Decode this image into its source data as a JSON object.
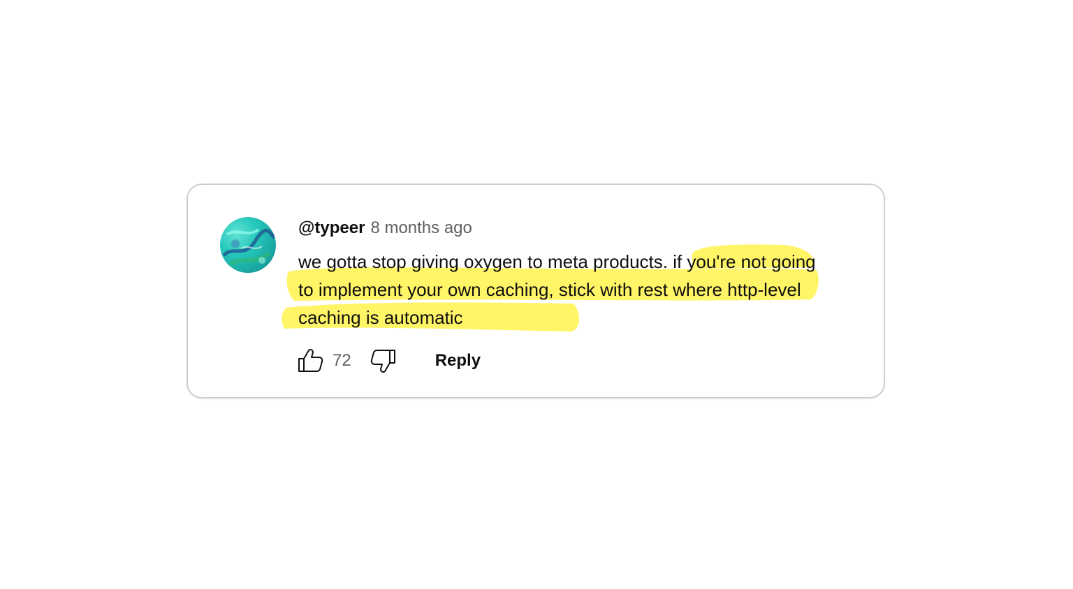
{
  "comment": {
    "author": "@typeer",
    "timestamp": "8 months ago",
    "text_plain": "we gotta stop giving oxygen to meta products",
    "text_highlighted": ". if you're not going to implement your own caching, stick with rest where http-level caching is automatic",
    "highlight_color": "#fff566",
    "likes": "72",
    "reply_label": "Reply"
  },
  "avatar": {
    "colors": [
      "#27c9bd",
      "#0f7f86",
      "#5fe3d4"
    ]
  },
  "icons": {
    "like": "thumbs-up-icon",
    "dislike": "thumbs-down-icon"
  }
}
